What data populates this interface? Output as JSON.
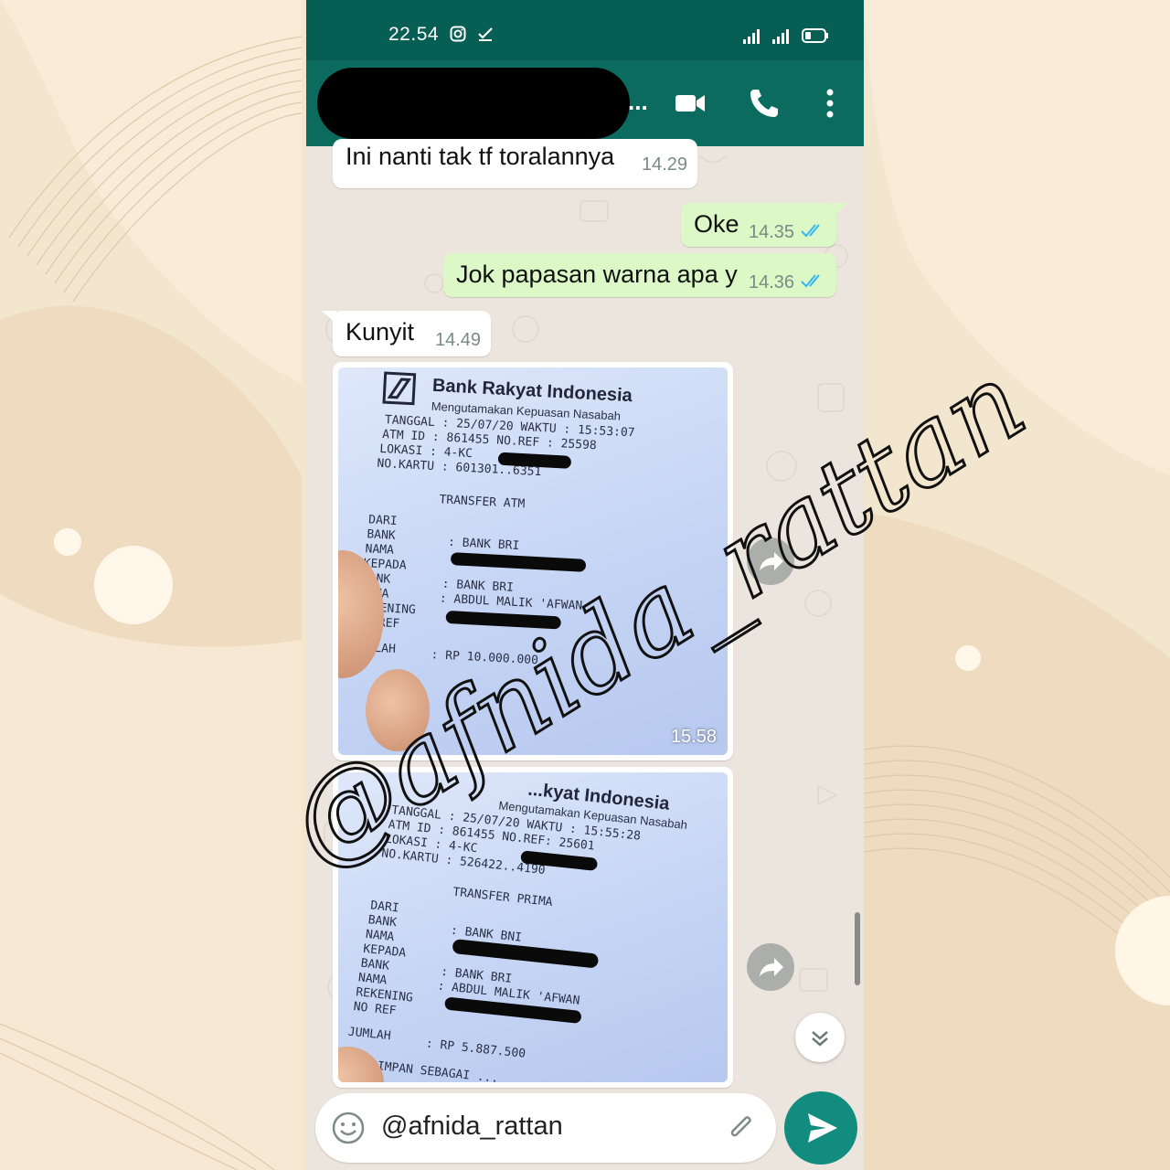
{
  "status_bar": {
    "time": "22.54"
  },
  "header": {
    "contact_name_suffix": "..."
  },
  "messages": [
    {
      "direction": "in",
      "text": "Ini nanti tak tf toralannya",
      "time": "14.29"
    },
    {
      "direction": "out",
      "text": "Oke",
      "time": "14.35",
      "status": "read"
    },
    {
      "direction": "out",
      "text": "Jok papasan warna apa y",
      "time": "14.36",
      "status": "read"
    },
    {
      "direction": "in",
      "text": "Kunyit",
      "time": "14.49"
    }
  ],
  "receipt1": {
    "time": "15.58",
    "bank": "Bank Rakyat Indonesia",
    "tagline": "Mengutamakan Kepuasan Nasabah",
    "l1": "TANGGAL  : 25/07/20   WAKTU  : 15:53:07",
    "l2": "ATM ID   : 861455     NO.REF : 25598",
    "l3": "LOKASI   : 4-KC",
    "l4": "NO.KARTU : 601301..6351",
    "type": "TRANSFER ATM",
    "l5": "DARI",
    "l6": "BANK",
    "l6v": ": BANK BRI",
    "l7": "NAMA",
    "l8": "KEPADA",
    "l9": "BANK",
    "l9v": ": BANK BRI",
    "l10": "NAMA",
    "l10v": ": ABDUL MALIK 'AFWAN",
    "l11": "REKENING",
    "l12": "NO REF",
    "l13": "JUMLAH",
    "l13v": ": RP       10.000.000"
  },
  "receipt2": {
    "bank": "...kyat Indonesia",
    "tagline": "Mengutamakan Kepuasan Nasabah",
    "l1": "TANGGAL  : 25/07/20   WAKTU : 15:55:28",
    "l2": "ATM ID   : 861455     NO.REF: 25601",
    "l3": "LOKASI   : 4-KC",
    "l4": "NO.KARTU : 526422..4190",
    "type": "TRANSFER PRIMA",
    "l5": "DARI",
    "l6": "BANK",
    "l6v": ": BANK BNI",
    "l7": "NAMA",
    "l8": "KEPADA",
    "l9": "BANK",
    "l9v": ": BANK BRI",
    "l10": "NAMA",
    "l10v": ": ABDUL MALIK 'AFWAN",
    "l11": "REKENING",
    "l12": "NO REF",
    "l13": "JUMLAH",
    "l13v": ": RP 5.887.500",
    "l14": "SIMPAN SEBAGAI ..."
  },
  "composer": {
    "value": "@afnida_rattan"
  },
  "watermark": {
    "text": "@afnida_rattan"
  },
  "colors": {
    "header": "#075e54",
    "outgoing": "#dcf8c6",
    "incoming": "#ffffff",
    "send": "#128c7e",
    "read_ticks": "#34b7f1"
  }
}
